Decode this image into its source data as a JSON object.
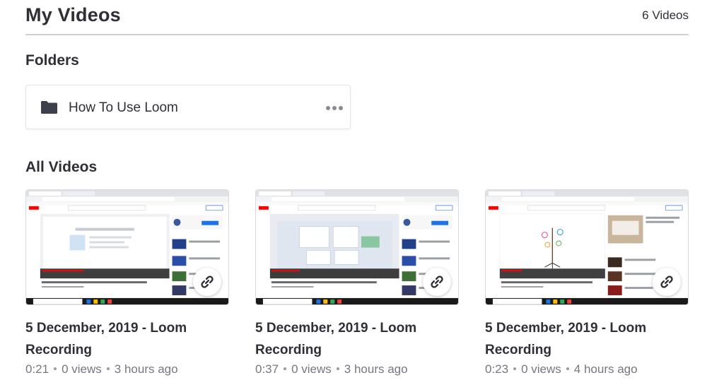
{
  "header": {
    "title": "My Videos",
    "count": "6 Videos"
  },
  "folders": {
    "title": "Folders",
    "items": [
      {
        "name": "How To Use Loom"
      }
    ]
  },
  "all_videos": {
    "title": "All Videos",
    "items": [
      {
        "title": "5 December, 2019 - Loom Recording",
        "duration": "0:21",
        "views": "0 views",
        "age": "3 hours ago",
        "variant": "a"
      },
      {
        "title": "5 December, 2019 - Loom Recording",
        "duration": "0:37",
        "views": "0 views",
        "age": "3 hours ago",
        "variant": "b"
      },
      {
        "title": "5 December, 2019 - Loom Recording",
        "duration": "0:23",
        "views": "0 views",
        "age": "4 hours ago",
        "variant": "c"
      }
    ]
  },
  "icons": {
    "folder": "folder-icon",
    "more": "more-icon",
    "link": "link-icon"
  },
  "colors": {
    "folder": "#3d3f4a",
    "accent": "#625df5",
    "divider": "#cfd0d4"
  }
}
